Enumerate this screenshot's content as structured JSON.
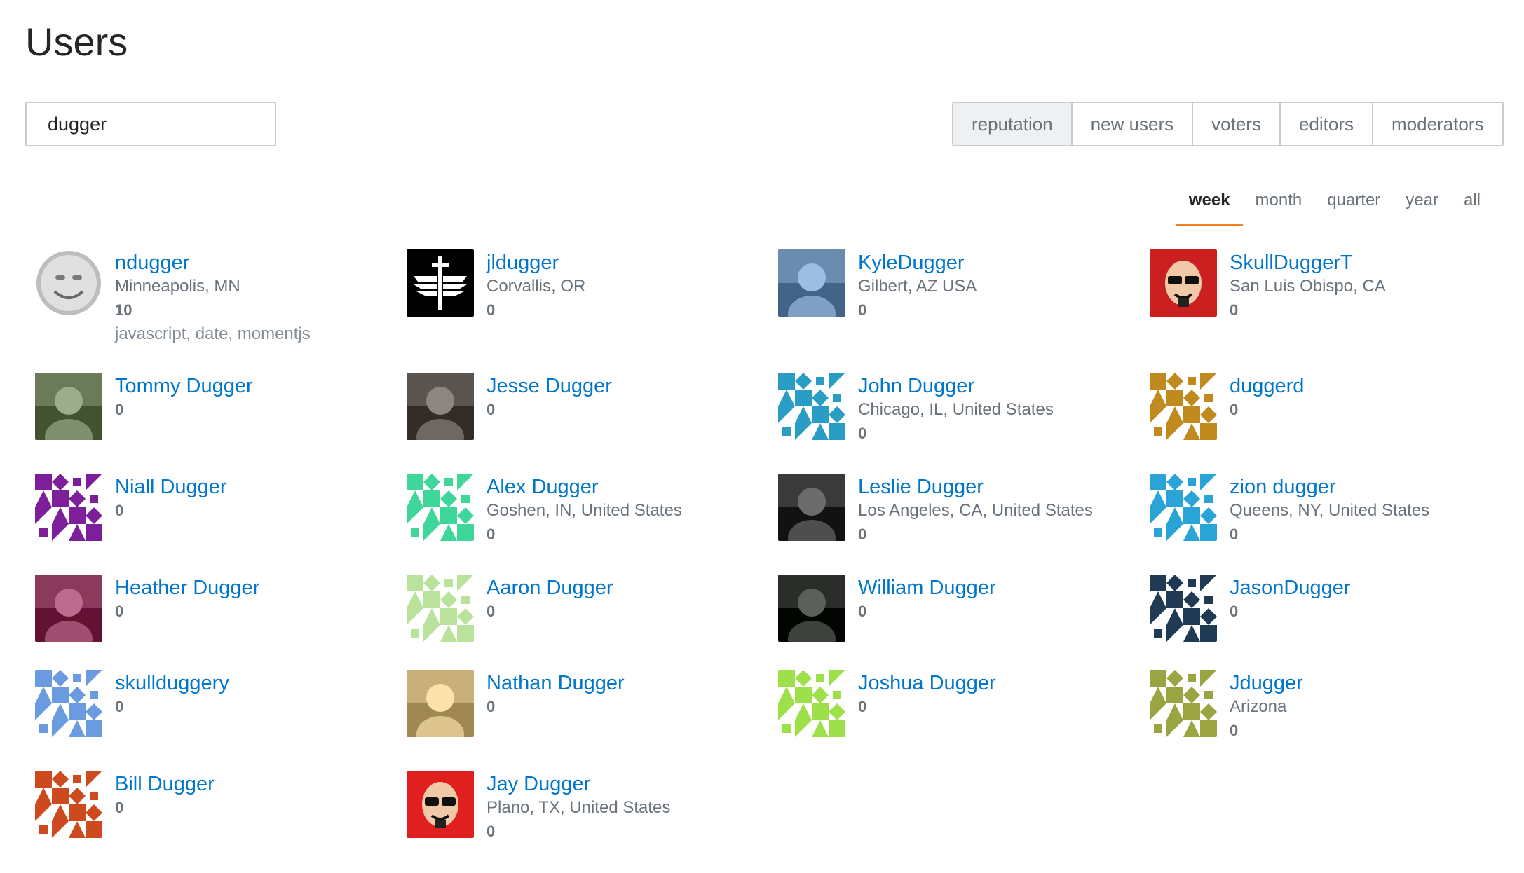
{
  "page": {
    "title": "Users"
  },
  "search": {
    "value": "dugger"
  },
  "filters": [
    {
      "label": "reputation",
      "active": true
    },
    {
      "label": "new users",
      "active": false
    },
    {
      "label": "voters",
      "active": false
    },
    {
      "label": "editors",
      "active": false
    },
    {
      "label": "moderators",
      "active": false
    }
  ],
  "periods": [
    {
      "label": "week",
      "active": true
    },
    {
      "label": "month",
      "active": false
    },
    {
      "label": "quarter",
      "active": false
    },
    {
      "label": "year",
      "active": false
    },
    {
      "label": "all",
      "active": false
    }
  ],
  "users": [
    {
      "name": "ndugger",
      "location": "Minneapolis, MN",
      "reputation": "10",
      "tags": "javascript, date, momentjs",
      "avatar": "moon-face-avatar",
      "color": "#aaaaaa"
    },
    {
      "name": "jldugger",
      "location": "Corvallis, OR",
      "reputation": "0",
      "tags": "",
      "avatar": "winged-sword-avatar",
      "color": "#000000"
    },
    {
      "name": "KyleDugger",
      "location": "Gilbert, AZ USA",
      "reputation": "0",
      "tags": "",
      "avatar": "photo-avatar",
      "color": "#6a8caf"
    },
    {
      "name": "SkullDuggerT",
      "location": "San Luis Obispo, CA",
      "reputation": "0",
      "tags": "",
      "avatar": "cartoon-face-avatar",
      "color": "#cc1f1f"
    },
    {
      "name": "Tommy Dugger",
      "location": "",
      "reputation": "0",
      "tags": "",
      "avatar": "photo-avatar",
      "color": "#6b7b5a"
    },
    {
      "name": "Jesse Dugger",
      "location": "",
      "reputation": "0",
      "tags": "",
      "avatar": "photo-avatar",
      "color": "#5a544e"
    },
    {
      "name": "John Dugger",
      "location": "Chicago, IL, United States",
      "reputation": "0",
      "tags": "",
      "avatar": "identicon-avatar",
      "color": "#2a9dc4"
    },
    {
      "name": "duggerd",
      "location": "",
      "reputation": "0",
      "tags": "",
      "avatar": "identicon-avatar",
      "color": "#c08a1e"
    },
    {
      "name": "Niall Dugger",
      "location": "",
      "reputation": "0",
      "tags": "",
      "avatar": "identicon-avatar",
      "color": "#7d1e9a"
    },
    {
      "name": "Alex Dugger",
      "location": "Goshen, IN, United States",
      "reputation": "0",
      "tags": "",
      "avatar": "identicon-avatar",
      "color": "#3fd69a"
    },
    {
      "name": "Leslie Dugger",
      "location": "Los Angeles, CA, United States",
      "reputation": "0",
      "tags": "",
      "avatar": "photo-avatar",
      "color": "#3a3a3a"
    },
    {
      "name": "zion dugger",
      "location": "Queens, NY, United States",
      "reputation": "0",
      "tags": "",
      "avatar": "identicon-avatar",
      "color": "#2aa3d6"
    },
    {
      "name": "Heather Dugger",
      "location": "",
      "reputation": "0",
      "tags": "",
      "avatar": "photo-avatar",
      "color": "#8a3a5a"
    },
    {
      "name": "Aaron Dugger",
      "location": "",
      "reputation": "0",
      "tags": "",
      "avatar": "identicon-avatar",
      "color": "#b9e29a"
    },
    {
      "name": "William Dugger",
      "location": "",
      "reputation": "0",
      "tags": "",
      "avatar": "photo-avatar",
      "color": "#2a2d2a"
    },
    {
      "name": "JasonDugger",
      "location": "",
      "reputation": "0",
      "tags": "",
      "avatar": "identicon-avatar",
      "color": "#1f3a52"
    },
    {
      "name": "skullduggery",
      "location": "",
      "reputation": "0",
      "tags": "",
      "avatar": "identicon-avatar",
      "color": "#6a9ae0"
    },
    {
      "name": "Nathan Dugger",
      "location": "",
      "reputation": "0",
      "tags": "",
      "avatar": "photo-avatar",
      "color": "#c9b07a"
    },
    {
      "name": "Joshua Dugger",
      "location": "",
      "reputation": "0",
      "tags": "",
      "avatar": "identicon-avatar",
      "color": "#9ee04a"
    },
    {
      "name": "Jdugger",
      "location": "Arizona",
      "reputation": "0",
      "tags": "",
      "avatar": "identicon-avatar",
      "color": "#9aa542"
    },
    {
      "name": "Bill Dugger",
      "location": "",
      "reputation": "0",
      "tags": "",
      "avatar": "identicon-avatar",
      "color": "#cc4a1e"
    },
    {
      "name": "Jay Dugger",
      "location": "Plano, TX, United States",
      "reputation": "0",
      "tags": "",
      "avatar": "cartoon-face-avatar",
      "color": "#e01f1f"
    }
  ]
}
